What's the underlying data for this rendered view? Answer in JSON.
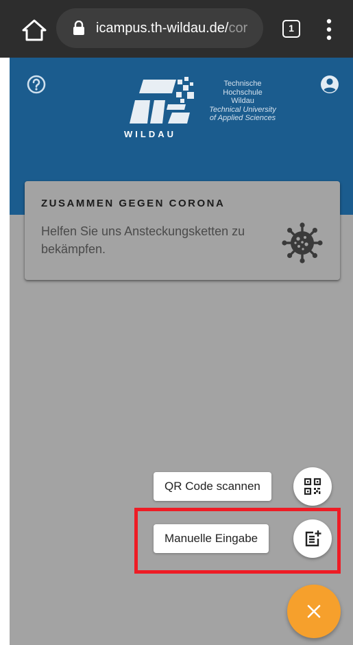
{
  "browser": {
    "url_visible": "icampus.th-wildau.de/",
    "url_faded": "cor",
    "tab_count": "1"
  },
  "header": {
    "logo_lines": [
      "Technische",
      "Hochschule",
      "Wildau"
    ],
    "logo_english_lines": [
      "Technical University",
      "of Applied Sciences"
    ],
    "logo_wordmark": "WILDAU",
    "background_color": "#1b5c8e"
  },
  "card": {
    "title": "ZUSAMMEN GEGEN CORONA",
    "body": "Helfen Sie uns Ansteckungsketten zu bekämpfen."
  },
  "speed_dial": {
    "qr_label": "QR Code scannen",
    "manual_label": "Manuelle Eingabe",
    "fab_color": "#f6a02c"
  },
  "highlight_color": "#ee1c25"
}
